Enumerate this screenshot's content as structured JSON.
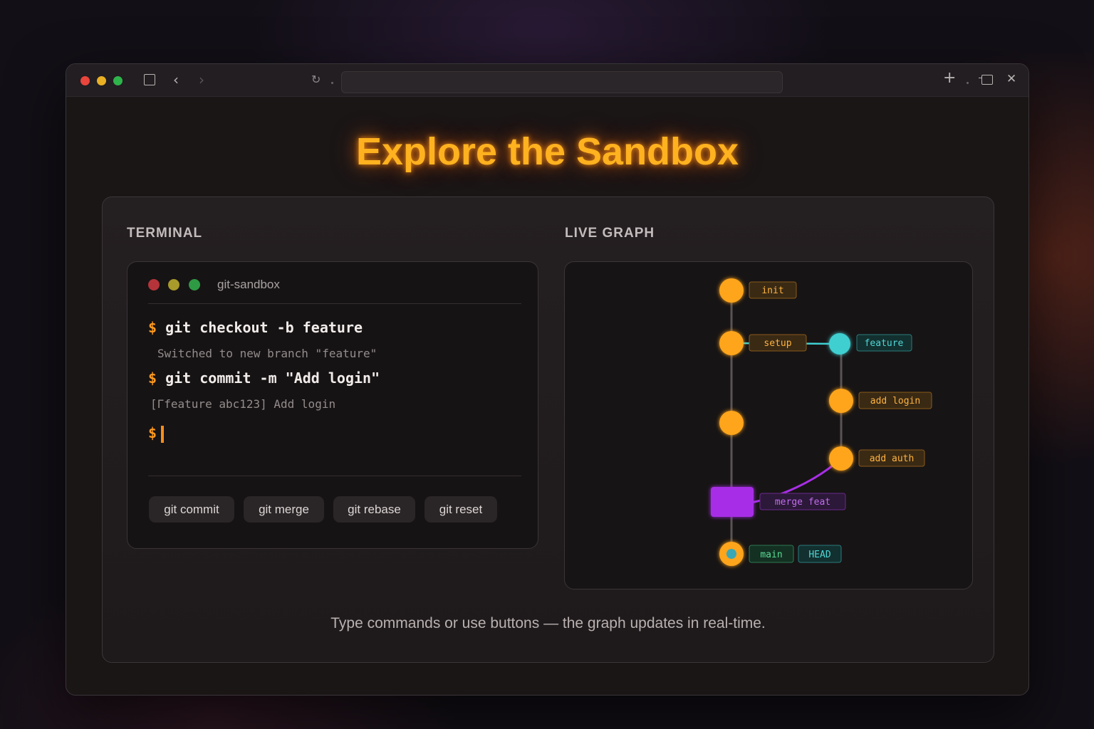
{
  "window": {
    "controls": [
      "close",
      "minimize",
      "zoom"
    ],
    "toolbar_icons": [
      "sidebar-icon",
      "back-icon",
      "forward-icon",
      "reload-icon",
      "new-tab-icon",
      "tab-overview-icon",
      "close-icon"
    ],
    "url_value": ""
  },
  "hero": {
    "title": "Explore the Sandbox"
  },
  "terminal": {
    "section_label": "TERMINAL",
    "window_title": "git-sandbox",
    "prompt": "$",
    "lines": [
      {
        "cmd": "git checkout -b feature",
        "out": "Switched to new branch \"feature\""
      },
      {
        "cmd": "git commit -m \"Add login\"",
        "out": "[Гfeature abc123] Add login"
      }
    ],
    "buttons": [
      "git commit",
      "git merge",
      "git rebase",
      "git reset"
    ]
  },
  "graph": {
    "section_label": "LIVE GRAPH",
    "commits": [
      {
        "id": "c1",
        "branch": "main",
        "label": "init"
      },
      {
        "id": "c2",
        "branch": "main",
        "label": "setup"
      },
      {
        "id": "f1",
        "branch": "feature",
        "label": "feature"
      },
      {
        "id": "f2",
        "branch": "feature",
        "label": "add login"
      },
      {
        "id": "c3",
        "branch": "main",
        "label": ""
      },
      {
        "id": "f3",
        "branch": "feature",
        "label": "add auth"
      },
      {
        "id": "m1",
        "branch": "main",
        "label": "merge feat"
      },
      {
        "id": "c4",
        "branch": "main",
        "label": ""
      }
    ],
    "refs": [
      "main",
      "HEAD"
    ],
    "colors": {
      "main": "#ffa51a",
      "feature": "#3fcfd0",
      "merge": "#a72ee6",
      "head": "#3fcfd0",
      "ref_main": "#4fd28a"
    }
  },
  "caption": "Type commands or use buttons — the graph updates in real-time."
}
